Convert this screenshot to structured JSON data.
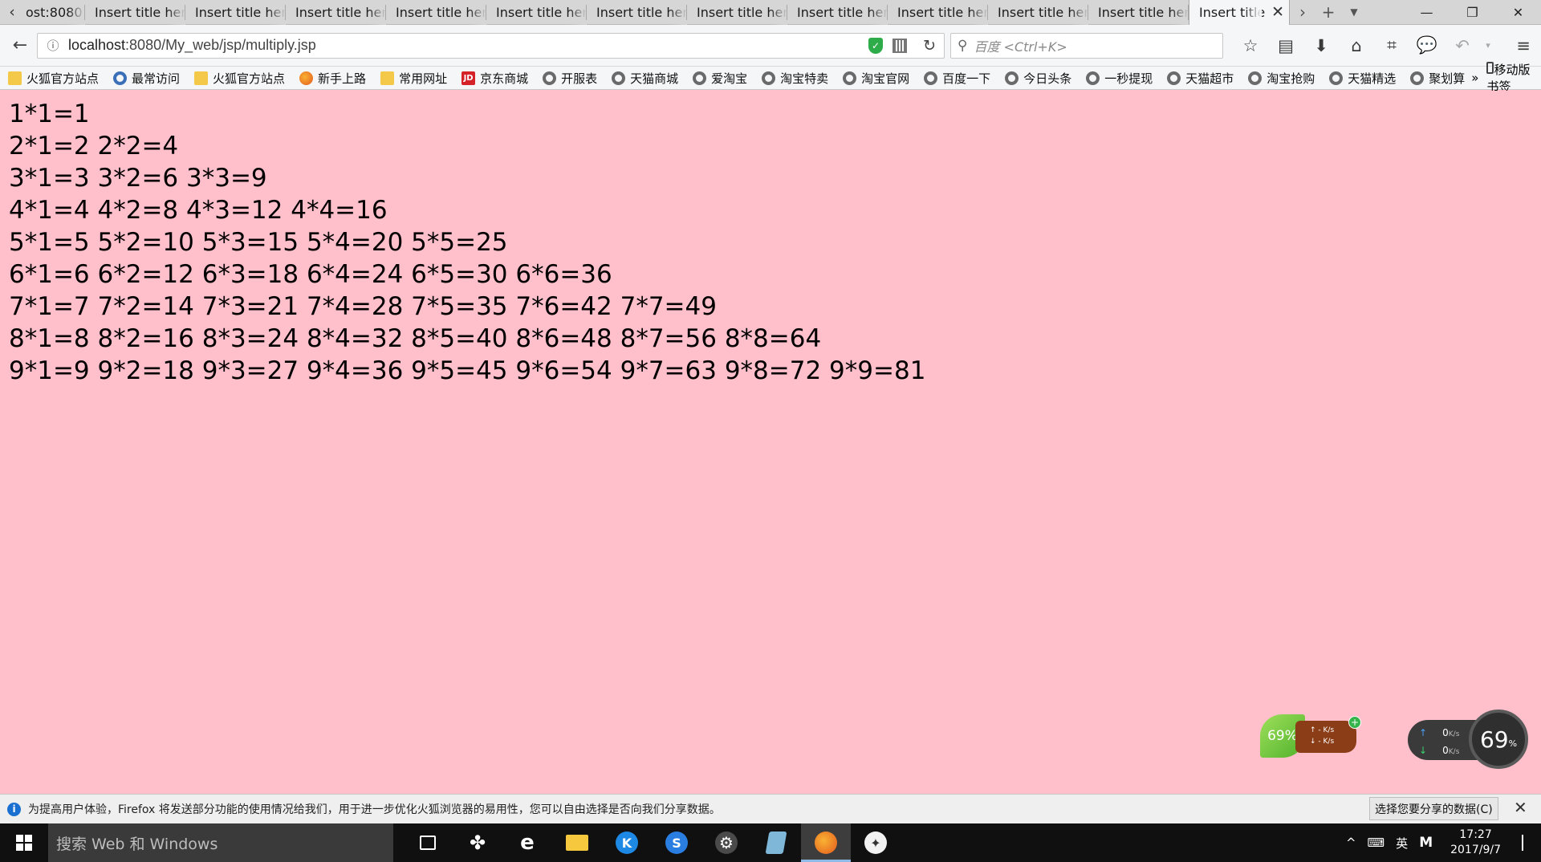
{
  "browser": {
    "tabs": [
      {
        "label": "ost:8080"
      },
      {
        "label": "Insert title her"
      },
      {
        "label": "Insert title her"
      },
      {
        "label": "Insert title her"
      },
      {
        "label": "Insert title her"
      },
      {
        "label": "Insert title her"
      },
      {
        "label": "Insert title her"
      },
      {
        "label": "Insert title her"
      },
      {
        "label": "Insert title her"
      },
      {
        "label": "Insert title her"
      },
      {
        "label": "Insert title her"
      },
      {
        "label": "Insert title her"
      },
      {
        "label": "Insert title"
      }
    ],
    "url_host": "localhost",
    "url_rest": ":8080/My_web/jsp/multiply.jsp",
    "search_placeholder": "百度 <Ctrl+K>"
  },
  "bookmarks": [
    {
      "label": "火狐官方站点",
      "icon": "folder-icon"
    },
    {
      "label": "最常访问",
      "icon": "globe-icon"
    },
    {
      "label": "火狐官方站点",
      "icon": "folder-icon"
    },
    {
      "label": "新手上路",
      "icon": "firefox-icon"
    },
    {
      "label": "常用网址",
      "icon": "folder-icon"
    },
    {
      "label": "京东商城",
      "icon": "jd-icon"
    },
    {
      "label": "开服表",
      "icon": "globe-icon"
    },
    {
      "label": "天猫商城",
      "icon": "globe-icon"
    },
    {
      "label": "爱淘宝",
      "icon": "globe-icon"
    },
    {
      "label": "淘宝特卖",
      "icon": "globe-icon"
    },
    {
      "label": "淘宝官网",
      "icon": "globe-icon"
    },
    {
      "label": "百度一下",
      "icon": "globe-icon"
    },
    {
      "label": "今日头条",
      "icon": "globe-icon"
    },
    {
      "label": "一秒提现",
      "icon": "globe-icon"
    },
    {
      "label": "天猫超市",
      "icon": "globe-icon"
    },
    {
      "label": "淘宝抢购",
      "icon": "globe-icon"
    },
    {
      "label": "天猫精选",
      "icon": "globe-icon"
    },
    {
      "label": "聚划算",
      "icon": "globe-icon"
    }
  ],
  "bookmarks_mobile_label": "移动版书签",
  "jd_badge": "JD",
  "content": {
    "rows": [
      "1*1=1",
      "2*1=2 2*2=4",
      "3*1=3 3*2=6 3*3=9",
      "4*1=4 4*2=8 4*3=12 4*4=16",
      "5*1=5 5*2=10 5*3=15 5*4=20 5*5=25",
      "6*1=6 6*2=12 6*3=18 6*4=24 6*5=30 6*6=36",
      "7*1=7 7*2=14 7*3=21 7*4=28 7*5=35 7*6=42 7*7=49",
      "8*1=8 8*2=16 8*3=24 8*4=32 8*5=40 8*6=48 8*7=56 8*8=64",
      "9*1=9 9*2=18 9*3=27 9*4=36 9*5=45 9*6=54 9*7=63 9*8=72 9*9=81"
    ]
  },
  "widgets": {
    "leaf_percent": "69%",
    "leaf_up": "- K/s",
    "leaf_down": "- K/s",
    "speed_up": "0",
    "speed_down": "0",
    "speed_unit": "K/s",
    "gauge_value": "69",
    "gauge_unit": "%"
  },
  "notice": {
    "text": "为提高用户体验，Firefox 将发送部分功能的使用情况给我们，用于进一步优化火狐浏览器的易用性，您可以自由选择是否向我们分享数据。",
    "button": "选择您要分享的数据(C)"
  },
  "taskbar": {
    "search_placeholder": "搜索 Web 和 Windows",
    "ime_label": "英",
    "time": "17:27",
    "date": "2017/9/7"
  }
}
